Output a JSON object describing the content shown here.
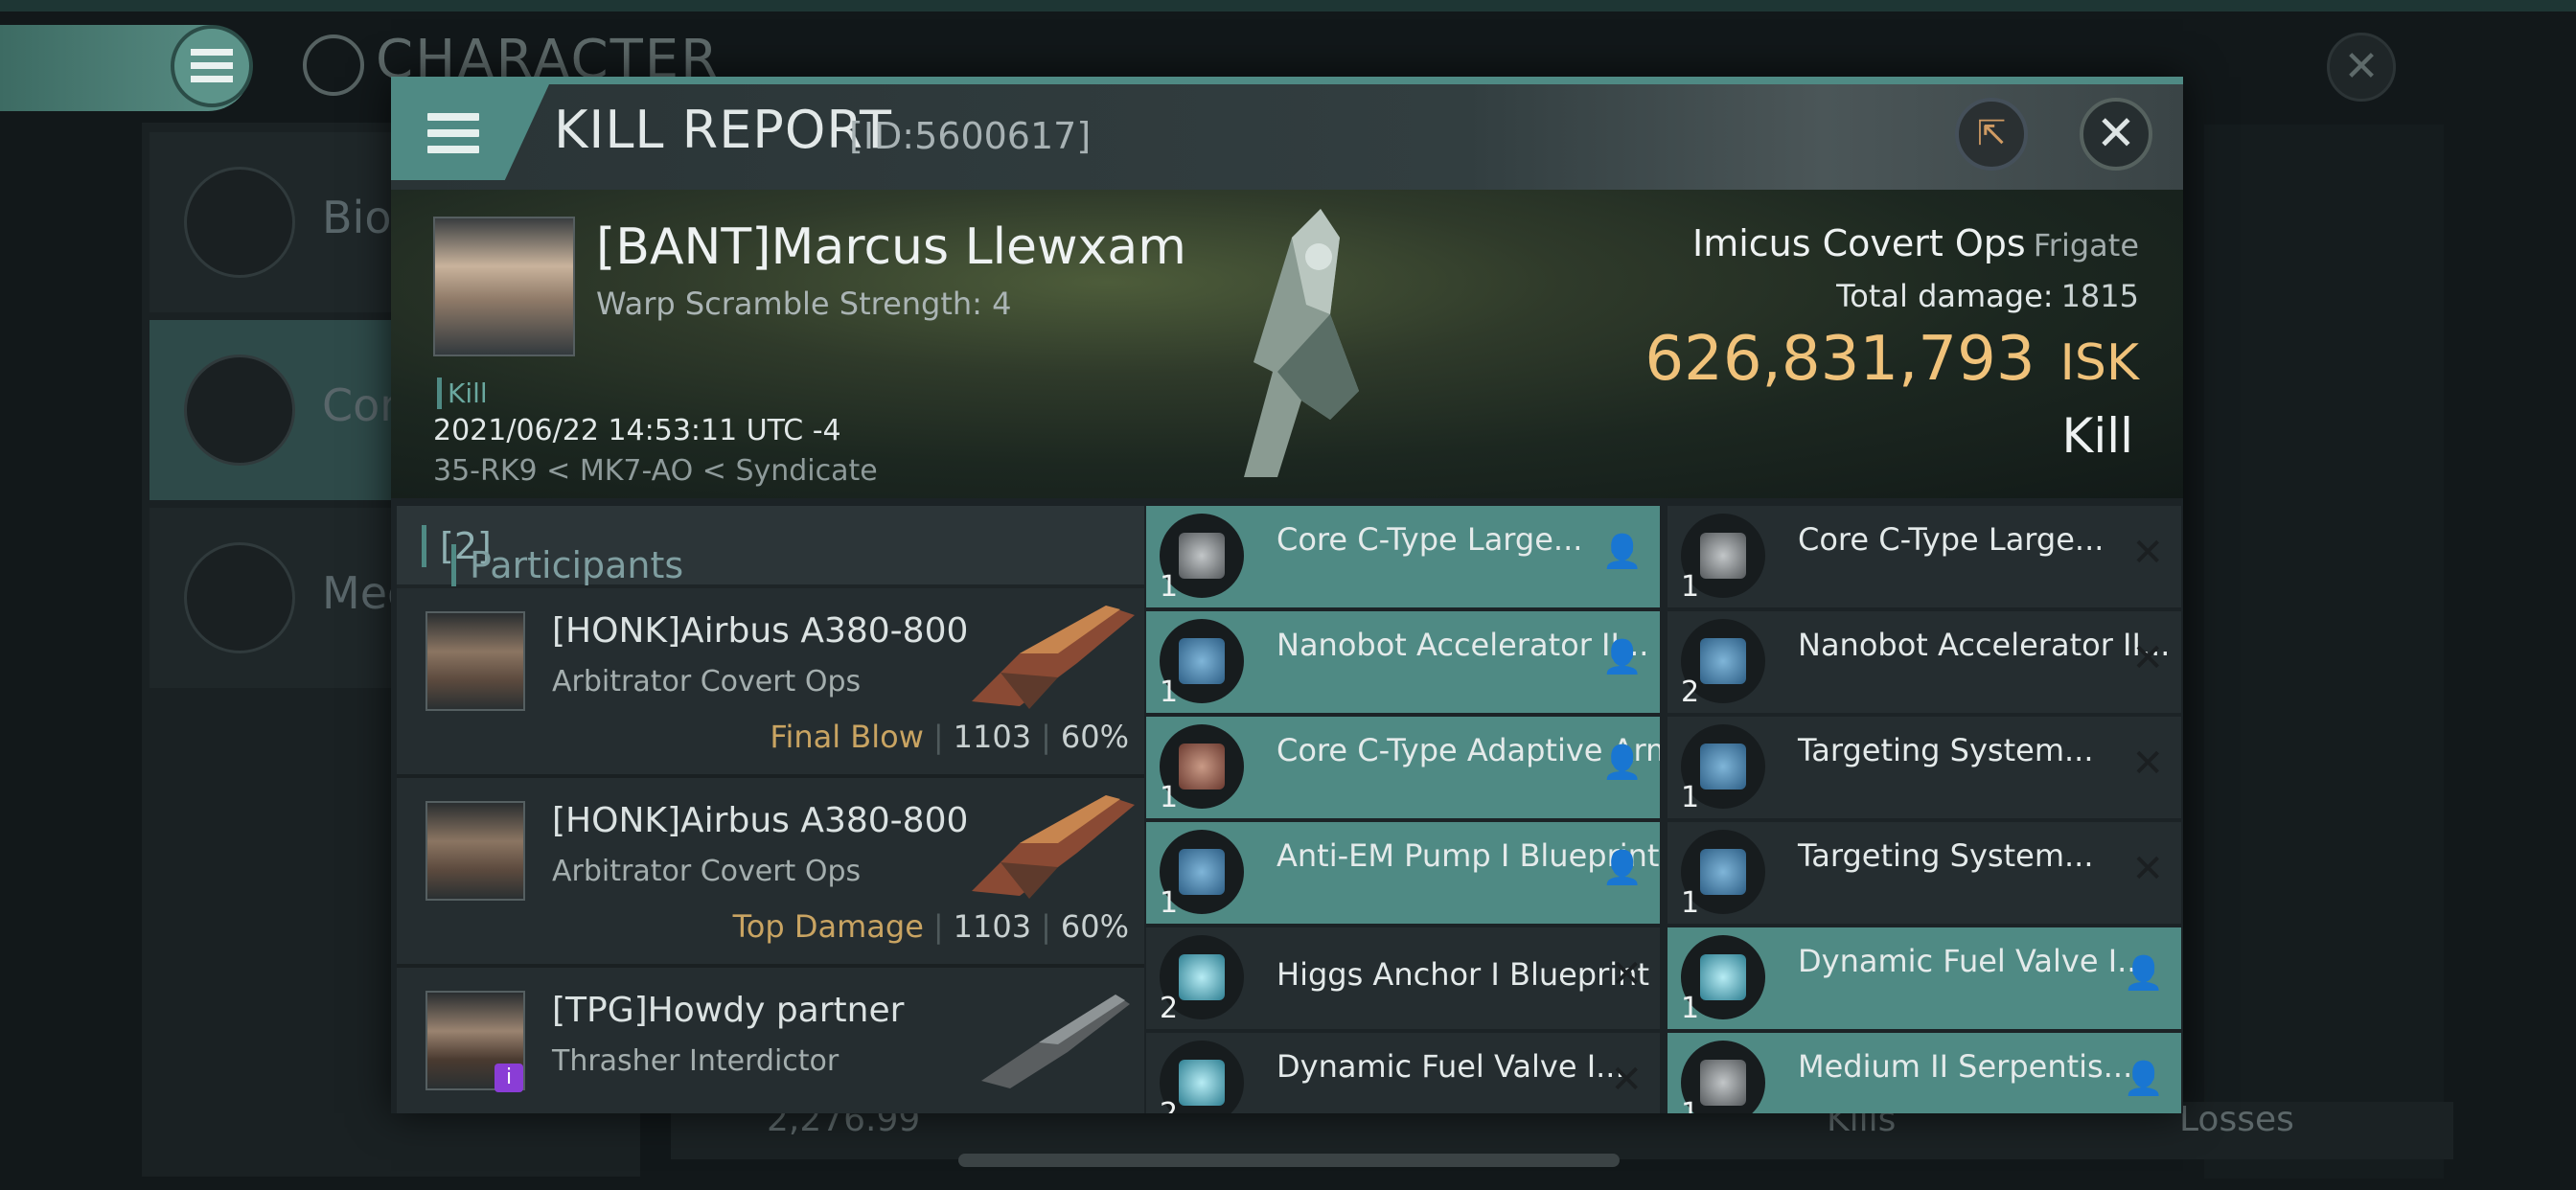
{
  "background": {
    "title": "CHARACTER",
    "close_glyph": "✕",
    "sidebar": [
      {
        "label": "Bio",
        "icon": "menu-lines-icon"
      },
      {
        "label": "Com",
        "icon": "crossed-swords-icon"
      },
      {
        "label": "Med",
        "icon": "star-badge-icon"
      }
    ],
    "bottom": {
      "value": "2,276.99",
      "kills": "Kills",
      "losses": "Losses"
    }
  },
  "modal": {
    "title": "KILL REPORT",
    "id": "[ID:5600617]",
    "share_glyph": "⇱",
    "close_glyph": "✕"
  },
  "victim": {
    "name": "[BANT]Marcus Llewxam",
    "detail": "Warp Scramble Strength: 4",
    "tag": "Kill",
    "date": "2021/06/22 14:53:11 UTC -4",
    "location": "35-RK9 < MK7-AO < Syndicate",
    "ship": "Imicus Covert Ops",
    "ship_class": "Frigate",
    "total_damage_label": "Total damage:",
    "total_damage": "1815",
    "isk_value": "626,831,793",
    "isk_unit": "ISK",
    "result": "Kill"
  },
  "participants": {
    "label": "Participants",
    "count": "[2]",
    "list": [
      {
        "name": "[HONK]Airbus A380-800",
        "ship": "Arbitrator Covert Ops",
        "tag": "Final Blow",
        "damage": "1103",
        "percent": "60%"
      },
      {
        "name": "[HONK]Airbus A380-800",
        "ship": "Arbitrator Covert Ops",
        "tag": "Top Damage",
        "damage": "1103",
        "percent": "60%"
      },
      {
        "name": "[TPG]Howdy partner",
        "ship": "Thrasher Interdictor",
        "tag": "",
        "damage": "",
        "percent": ""
      }
    ]
  },
  "items": [
    {
      "name": "Core C-Type Large...",
      "qty": "1",
      "flag": "person",
      "highlight": true
    },
    {
      "name": "Core C-Type Large...",
      "qty": "1",
      "flag": "x",
      "highlight": false
    },
    {
      "name": "Nanobot Accelerator II...",
      "qty": "1",
      "flag": "person",
      "highlight": true
    },
    {
      "name": "Nanobot Accelerator II...",
      "qty": "2",
      "flag": "x",
      "highlight": false
    },
    {
      "name": "Core C-Type Adaptive Armo...",
      "qty": "1",
      "flag": "person",
      "highlight": true
    },
    {
      "name": "Targeting System...",
      "qty": "1",
      "flag": "x",
      "highlight": false
    },
    {
      "name": "Anti-EM Pump I Blueprint",
      "qty": "1",
      "flag": "person",
      "highlight": true
    },
    {
      "name": "Targeting System...",
      "qty": "1",
      "flag": "x",
      "highlight": false
    },
    {
      "name": "Higgs Anchor I Blueprint",
      "qty": "2",
      "flag": "x",
      "highlight": false
    },
    {
      "name": "Dynamic Fuel Valve I...",
      "qty": "1",
      "flag": "person",
      "highlight": true
    },
    {
      "name": "Dynamic Fuel Valve I...",
      "qty": "2",
      "flag": "x",
      "highlight": false
    },
    {
      "name": "Medium II Serpentis...",
      "qty": "1",
      "flag": "person",
      "highlight": true
    }
  ]
}
